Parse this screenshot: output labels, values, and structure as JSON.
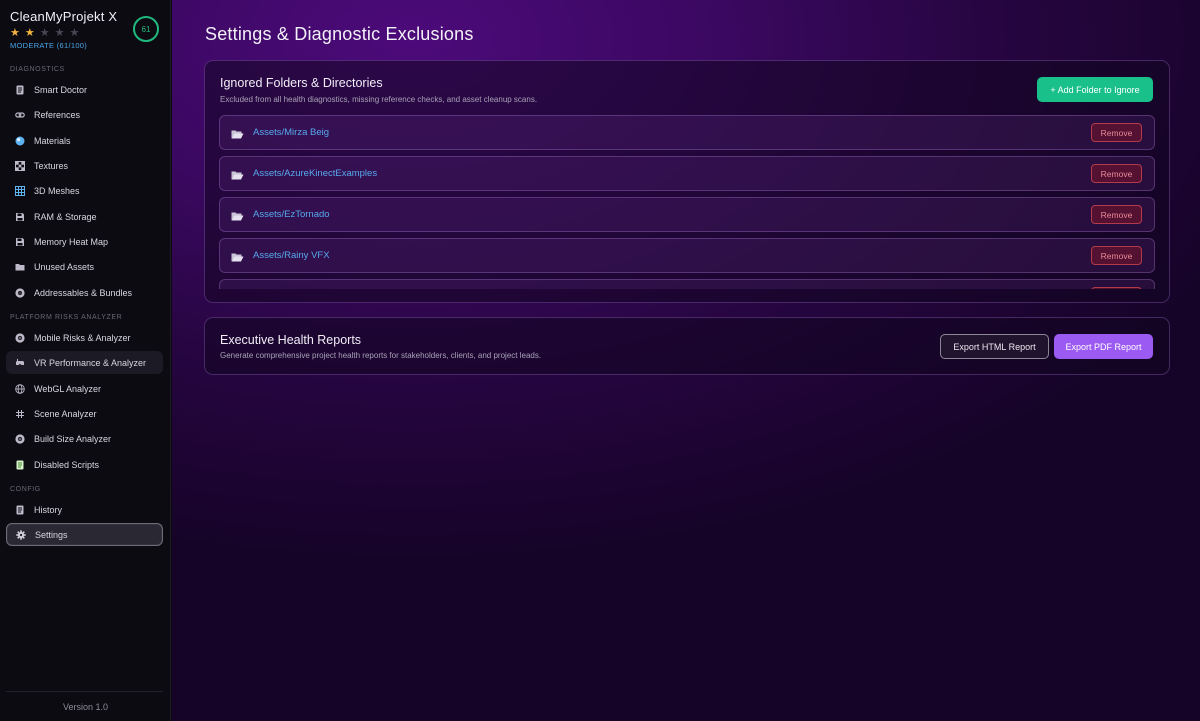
{
  "app": {
    "title": "CleanMyProjekt X",
    "rating_stars_filled": 2,
    "rating_stars_total": 5,
    "health_status": "MODERATE (61/100)",
    "health_score": "61",
    "version": "Version 1.0"
  },
  "colors": {
    "accent_green": "#19c08a",
    "accent_purple": "#9b5af2",
    "link_blue": "#56a9ee",
    "danger_red": "#b23a4a",
    "star_gold": "#f2b33d"
  },
  "sidebar": {
    "sections": [
      {
        "label": "DIAGNOSTICS",
        "items": [
          {
            "label": "Smart Doctor",
            "icon": "document-icon"
          },
          {
            "label": "References",
            "icon": "link-icon"
          },
          {
            "label": "Materials",
            "icon": "sphere-icon"
          },
          {
            "label": "Textures",
            "icon": "checker-icon"
          },
          {
            "label": "3D Meshes",
            "icon": "grid-icon"
          },
          {
            "label": "RAM & Storage",
            "icon": "floppy-icon"
          },
          {
            "label": "Memory Heat Map",
            "icon": "floppy-icon"
          },
          {
            "label": "Unused Assets",
            "icon": "folder-icon"
          },
          {
            "label": "Addressables & Bundles",
            "icon": "radiation-icon"
          }
        ]
      },
      {
        "label": "PLATFORM RISKS ANALYZER",
        "items": [
          {
            "label": "Mobile Risks & Analyzer",
            "icon": "radiation-icon"
          },
          {
            "label": "VR Performance & Analyzer",
            "icon": "vr-icon"
          },
          {
            "label": "WebGL Analyzer",
            "icon": "globe-icon"
          },
          {
            "label": "Scene Analyzer",
            "icon": "hash-icon"
          },
          {
            "label": "Build Size Analyzer",
            "icon": "radiation-icon"
          },
          {
            "label": "Disabled Scripts",
            "icon": "script-icon"
          }
        ]
      },
      {
        "label": "CONFIG",
        "items": [
          {
            "label": "History",
            "icon": "document-icon"
          },
          {
            "label": "Settings",
            "icon": "gear-icon"
          }
        ]
      }
    ]
  },
  "main": {
    "page_title": "Settings & Diagnostic Exclusions",
    "ignored": {
      "title": "Ignored Folders & Directories",
      "subtitle": "Excluded from all health diagnostics, missing reference checks, and asset cleanup scans.",
      "add_button": "+ Add Folder to Ignore",
      "remove_label": "Remove",
      "folders": [
        "Assets/Mirza Beig",
        "Assets/AzureKinectExamples",
        "Assets/EzTornado",
        "Assets/Rainy VFX"
      ]
    },
    "reports": {
      "title": "Executive Health Reports",
      "subtitle": "Generate comprehensive project health reports for stakeholders, clients, and project leads.",
      "export_html": "Export HTML Report",
      "export_pdf": "Export PDF Report"
    }
  }
}
